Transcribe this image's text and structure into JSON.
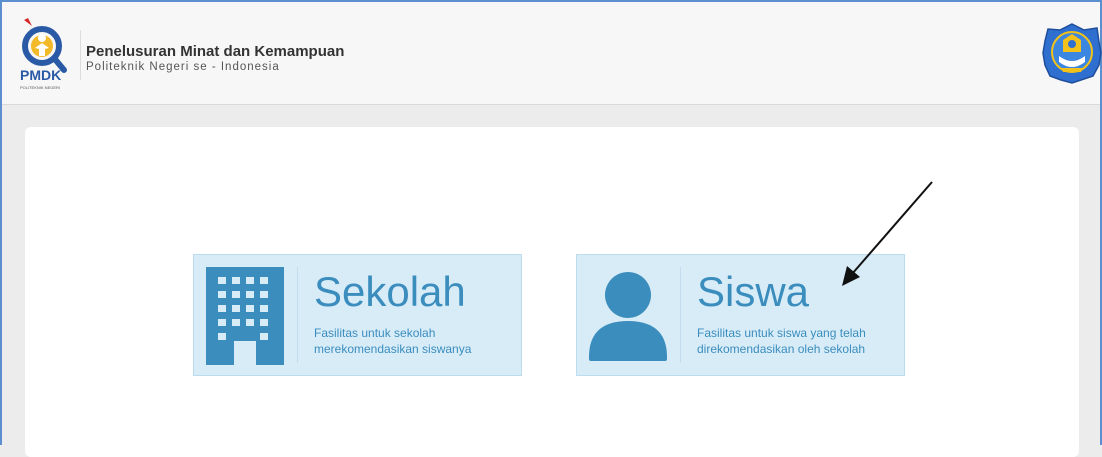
{
  "header": {
    "title": "Penelusuran Minat dan Kemampuan",
    "subtitle": "Politeknik Negeri se - Indonesia",
    "logo_text": "PMDK",
    "logo_caption": "POLITEKNIK NEGERI"
  },
  "cards": [
    {
      "title": "Sekolah",
      "desc_line1": "Fasilitas untuk sekolah",
      "desc_line2": "merekomendasikan siswanya",
      "icon": "building-icon"
    },
    {
      "title": "Siswa",
      "desc_line1": "Fasilitas untuk siswa yang telah",
      "desc_line2": "direkomendasikan oleh sekolah",
      "icon": "user-icon"
    }
  ],
  "colors": {
    "accent": "#3a8dbd",
    "card_bg": "#d8ecf8",
    "window_border": "#5b8fd0"
  }
}
